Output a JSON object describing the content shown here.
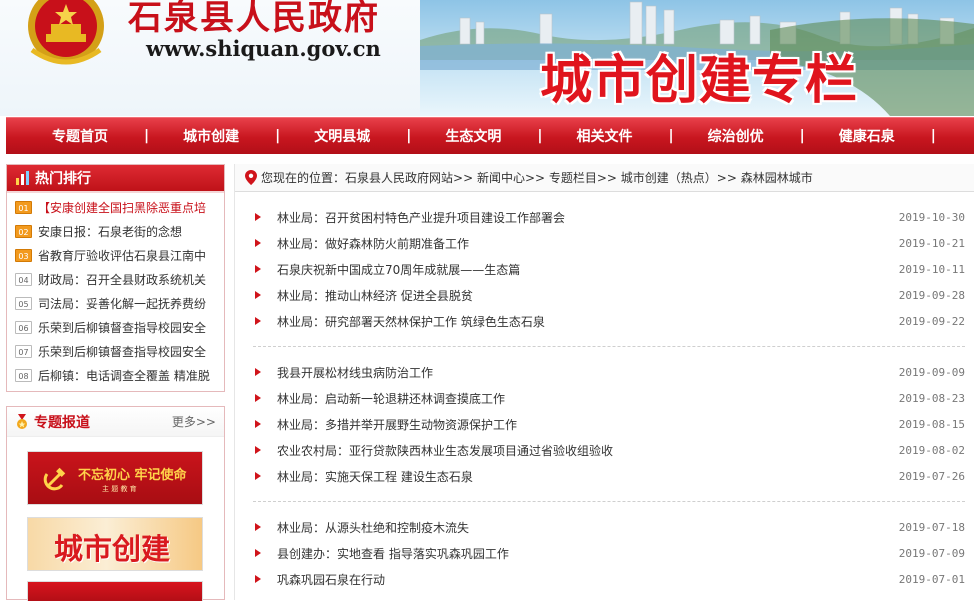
{
  "banner": {
    "gov_name": "石泉县人民政府",
    "url": "www.shiquan.gov.cn",
    "column_title": "城市创建专栏"
  },
  "nav": {
    "items": [
      {
        "label": "专题首页"
      },
      {
        "label": "城市创建"
      },
      {
        "label": "文明县城"
      },
      {
        "label": "生态文明"
      },
      {
        "label": "相关文件"
      },
      {
        "label": "综治创优"
      },
      {
        "label": "健康石泉"
      }
    ],
    "separator": "|"
  },
  "hot_ranking": {
    "title": "热门排行",
    "items": [
      {
        "num": "01",
        "text": "【安康创建全国扫黑除恶重点培"
      },
      {
        "num": "02",
        "text": "安康日报：石泉老街的念想"
      },
      {
        "num": "03",
        "text": "省教育厅验收评估石泉县江南中"
      },
      {
        "num": "04",
        "text": "财政局：召开全县财政系统机关"
      },
      {
        "num": "05",
        "text": "司法局：妥善化解一起抚养费纷"
      },
      {
        "num": "06",
        "text": "乐荣到后柳镇督查指导校园安全"
      },
      {
        "num": "07",
        "text": "乐荣到后柳镇督查指导校园安全"
      },
      {
        "num": "08",
        "text": "后柳镇：电话调查全覆盖 精准脱"
      }
    ]
  },
  "special": {
    "title": "专题报道",
    "more": "更多>>",
    "promo1_text": "不忘初心 牢记使命",
    "promo1_sub": "主 题 教 育",
    "promo2_text": "城市创建"
  },
  "breadcrumb": {
    "lead": "您现在的位置：",
    "path": "石泉县人民政府网站>> 新闻中心>> 专题栏目>> 城市创建（热点）>> 森林园林城市"
  },
  "news_groups": [
    [
      {
        "title": "林业局：召开贫困村特色产业提升项目建设工作部署会",
        "date": "2019-10-30"
      },
      {
        "title": "林业局：做好森林防火前期准备工作",
        "date": "2019-10-21"
      },
      {
        "title": "石泉庆祝新中国成立70周年成就展——生态篇",
        "date": "2019-10-11"
      },
      {
        "title": "林业局：推动山林经济 促进全县脱贫",
        "date": "2019-09-28"
      },
      {
        "title": "林业局：研究部署天然林保护工作 筑绿色生态石泉",
        "date": "2019-09-22"
      }
    ],
    [
      {
        "title": "我县开展松材线虫病防治工作",
        "date": "2019-09-09"
      },
      {
        "title": "林业局：启动新一轮退耕还林调查摸底工作",
        "date": "2019-08-23"
      },
      {
        "title": "林业局：多措并举开展野生动物资源保护工作",
        "date": "2019-08-15"
      },
      {
        "title": "农业农村局：亚行贷款陕西林业生态发展项目通过省验收组验收",
        "date": "2019-08-02"
      },
      {
        "title": "林业局：实施天保工程 建设生态石泉",
        "date": "2019-07-26"
      }
    ],
    [
      {
        "title": "林业局：从源头杜绝和控制疫木流失",
        "date": "2019-07-18"
      },
      {
        "title": "县创建办：实地查看 指导落实巩森巩园工作",
        "date": "2019-07-09"
      },
      {
        "title": "巩森巩园石泉在行动",
        "date": "2019-07-01"
      }
    ]
  ],
  "colors": {
    "brand_red": "#c8101a",
    "nav_red": "#c8161f",
    "bullet_red": "#d0141b"
  }
}
